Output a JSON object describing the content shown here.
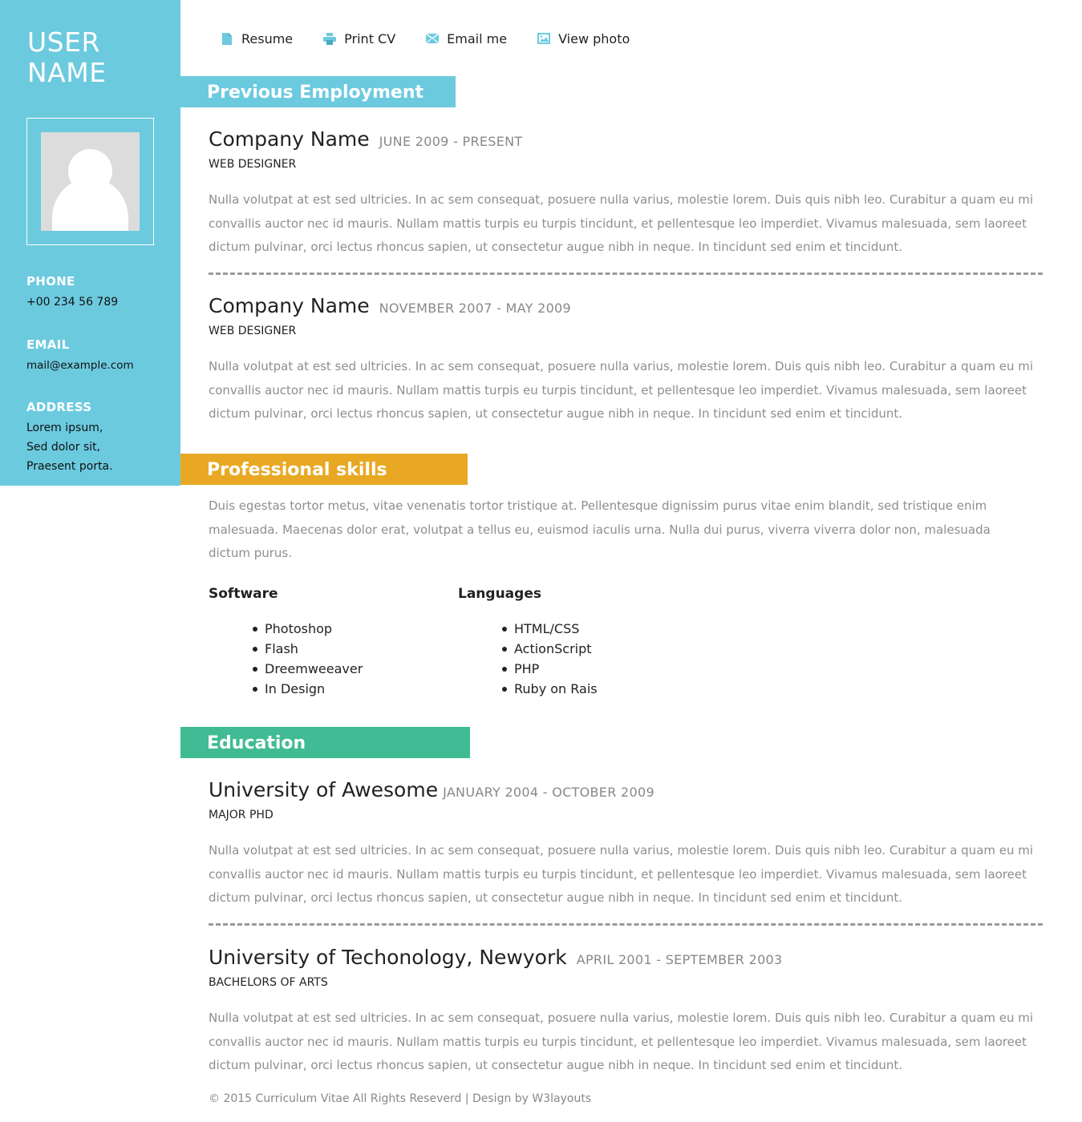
{
  "sidebar": {
    "username_line1": "USER",
    "username_line2": "NAME",
    "phone_label": "PHONE",
    "phone": "+00 234 56 789",
    "email_label": "EMAIL",
    "email": "mail@example.com",
    "address_label": "ADDRESS",
    "address_lines": [
      "Lorem ipsum,",
      "Sed dolor sit,",
      "Praesent porta."
    ],
    "color": "#6ccadf"
  },
  "nav": [
    {
      "label": "Resume",
      "icon": "document-icon"
    },
    {
      "label": "Print CV",
      "icon": "printer-icon"
    },
    {
      "label": "Email me",
      "icon": "envelope-icon"
    },
    {
      "label": "View photo",
      "icon": "image-icon"
    }
  ],
  "employment": {
    "heading": "Previous Employment",
    "color": "#6ccadf",
    "entries": [
      {
        "company": "Company Name",
        "dates": "JUNE 2009 - PRESENT",
        "role": "WEB DESIGNER",
        "text": "Nulla volutpat at est sed ultricies. In ac sem consequat, posuere nulla varius, molestie lorem. Duis quis nibh leo. Curabitur a quam eu mi convallis auctor nec id mauris. Nullam mattis turpis eu turpis tincidunt, et pellentesque leo imperdiet. Vivamus malesuada, sem laoreet dictum pulvinar, orci lectus rhoncus sapien, ut consectetur augue nibh in neque. In tincidunt sed enim et tincidunt."
      },
      {
        "company": "Company Name",
        "dates": "NOVEMBER 2007 - MAY 2009",
        "role": "WEB DESIGNER",
        "text": "Nulla volutpat at est sed ultricies. In ac sem consequat, posuere nulla varius, molestie lorem. Duis quis nibh leo. Curabitur a quam eu mi convallis auctor nec id mauris. Nullam mattis turpis eu turpis tincidunt, et pellentesque leo imperdiet. Vivamus malesuada, sem laoreet dictum pulvinar, orci lectus rhoncus sapien, ut consectetur augue nibh in neque. In tincidunt sed enim et tincidunt."
      }
    ]
  },
  "skills": {
    "heading": "Professional skills",
    "color": "#e8a823",
    "intro": "Duis egestas tortor metus, vitae venenatis tortor tristique at. Pellentesque dignissim purus vitae enim blandit, sed tristique enim malesuada. Maecenas dolor erat, volutpat a tellus eu, euismod iaculis urna. Nulla dui purus, viverra viverra dolor non, malesuada dictum purus.",
    "software_label": "Software",
    "software": [
      "Photoshop",
      "Flash",
      "Dreemweeaver",
      "In Design"
    ],
    "languages_label": "Languages",
    "languages": [
      "HTML/CSS",
      "ActionScript",
      "PHP",
      "Ruby on Rais"
    ]
  },
  "education": {
    "heading": "Education",
    "color": "#40bb93",
    "entries": [
      {
        "school": "University of Awesome",
        "dates": "JANUARY 2004 - OCTOBER 2009",
        "degree": "MAJOR PHD",
        "text": "Nulla volutpat at est sed ultricies. In ac sem consequat, posuere nulla varius, molestie lorem. Duis quis nibh leo. Curabitur a quam eu mi convallis auctor nec id mauris. Nullam mattis turpis eu turpis tincidunt, et pellentesque leo imperdiet. Vivamus malesuada, sem laoreet dictum pulvinar, orci lectus rhoncus sapien, ut consectetur augue nibh in neque. In tincidunt sed enim et tincidunt."
      },
      {
        "school": "University of Techonology, Newyork",
        "dates": "APRIL 2001 - SEPTEMBER 2003",
        "degree": "BACHELORS OF ARTS",
        "text": "Nulla volutpat at est sed ultricies. In ac sem consequat, posuere nulla varius, molestie lorem. Duis quis nibh leo. Curabitur a quam eu mi convallis auctor nec id mauris. Nullam mattis turpis eu turpis tincidunt, et pellentesque leo imperdiet. Vivamus malesuada, sem laoreet dictum pulvinar, orci lectus rhoncus sapien, ut consectetur augue nibh in neque. In tincidunt sed enim et tincidunt."
      }
    ]
  },
  "footer": {
    "text": "© 2015 Curriculum Vitae All Rights Reseverd | Design by W3layouts"
  }
}
